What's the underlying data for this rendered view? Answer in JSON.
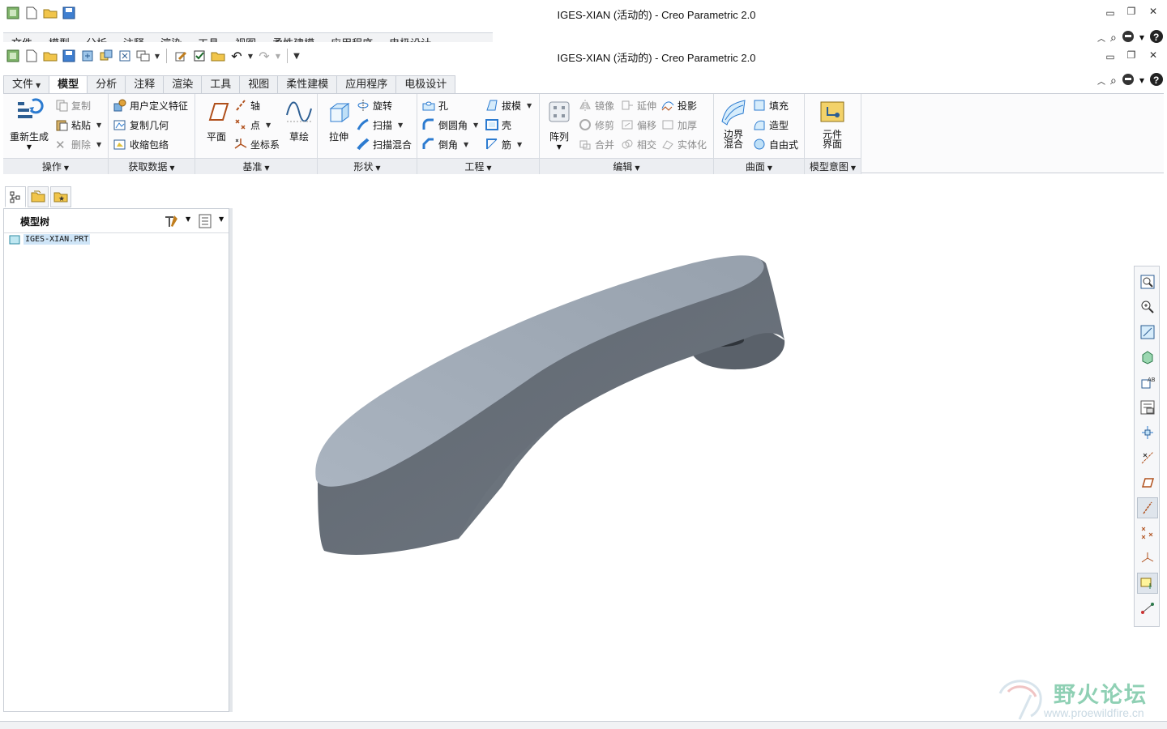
{
  "window": {
    "title": "IGES-XIAN (活动的) - Creo Parametric 2.0",
    "ghost_title": "IGES-XIAN (活动的) - Creo Parametric 2.0"
  },
  "ghost_tabs": [
    "文件",
    "模型",
    "分析",
    "注释",
    "渲染",
    "工具",
    "视图",
    "柔性建模",
    "应用程序",
    "电极设计"
  ],
  "ribbon_tabs": {
    "file": "文件",
    "model": "模型",
    "analysis": "分析",
    "annotate": "注释",
    "render": "渲染",
    "tools": "工具",
    "view": "视图",
    "flexible": "柔性建模",
    "applications": "应用程序",
    "electrode": "电极设计"
  },
  "ribbon": {
    "operations": {
      "label": "操作",
      "regenerate": "重新生成",
      "copy": "复制",
      "paste": "粘贴",
      "delete": "删除"
    },
    "get_data": {
      "label": "获取数据",
      "udf": "用户定义特征",
      "copy_geom": "复制几何",
      "shrinkwrap": "收缩包络"
    },
    "datum": {
      "label": "基准",
      "plane": "平面",
      "axis": "轴",
      "point": "点",
      "csys": "坐标系",
      "sketch": "草绘"
    },
    "shapes": {
      "label": "形状",
      "extrude": "拉伸",
      "revolve": "旋转",
      "sweep": "扫描",
      "swept_blend": "扫描混合"
    },
    "engineering": {
      "label": "工程",
      "hole": "孔",
      "round": "倒圆角",
      "chamfer": "倒角",
      "draft": "拔模",
      "shell": "壳",
      "rib": "筋"
    },
    "editing": {
      "label": "编辑",
      "pattern": "阵列",
      "mirror": "镜像",
      "trim": "修剪",
      "merge": "合并",
      "extend": "延伸",
      "offset": "偏移",
      "intersect": "相交",
      "project": "投影",
      "thicken": "加厚",
      "solidify": "实体化"
    },
    "surfaces": {
      "label": "曲面",
      "boundary_blend": "边界混合",
      "fill": "填充",
      "style": "造型",
      "freestyle": "自由式"
    },
    "model_intent": {
      "label": "模型意图",
      "component_interface": "元件界面"
    }
  },
  "model_tree": {
    "title": "模型树",
    "root_item": "IGES-XIAN.PRT"
  },
  "watermark": {
    "title": "野火论坛",
    "url": "www.proewildfire.cn"
  },
  "colors": {
    "part_top": "#a3adb8",
    "part_side": "#6e7680",
    "accent": "#2f6fb8"
  }
}
